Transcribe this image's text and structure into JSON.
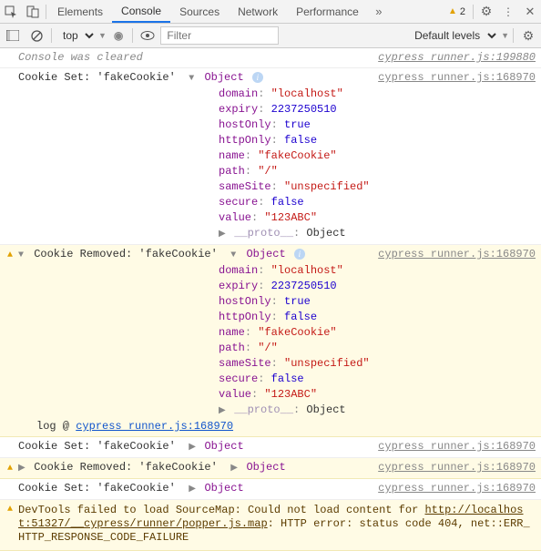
{
  "toolbar": {
    "tabs": [
      "Elements",
      "Console",
      "Sources",
      "Network",
      "Performance"
    ],
    "active_tab": "Console",
    "warning_count": "2"
  },
  "toolbar2": {
    "context": "top",
    "filter_placeholder": "Filter",
    "levels": "Default levels"
  },
  "messages": {
    "cleared": "Console was cleared",
    "cookie_set_label": "Cookie Set: 'fakeCookie'",
    "cookie_removed_label": "Cookie Removed: 'fakeCookie'",
    "object_label": "Object",
    "proto_label": "__proto__",
    "log_at_prefix": "log @ ",
    "log_at_link": "cypress runner.js:168970"
  },
  "sources": {
    "s199880": "cypress runner.js:199880",
    "s168970": "cypress runner.js:168970"
  },
  "cookie_obj": {
    "domain": {
      "k": "domain",
      "v": "\"localhost\"",
      "t": "str"
    },
    "expiry": {
      "k": "expiry",
      "v": "2237250510",
      "t": "num"
    },
    "hostOnly": {
      "k": "hostOnly",
      "v": "true",
      "t": "bool"
    },
    "httpOnly": {
      "k": "httpOnly",
      "v": "false",
      "t": "bool"
    },
    "name": {
      "k": "name",
      "v": "\"fakeCookie\"",
      "t": "str"
    },
    "path": {
      "k": "path",
      "v": "\"/\"",
      "t": "str"
    },
    "sameSite": {
      "k": "sameSite",
      "v": "\"unspecified\"",
      "t": "str"
    },
    "secure": {
      "k": "secure",
      "v": "false",
      "t": "bool"
    },
    "value": {
      "k": "value",
      "v": "\"123ABC\"",
      "t": "str"
    }
  },
  "sourcemap": {
    "pre": "DevTools failed to load SourceMap: Could not load content for ",
    "url": "http://localhost:51327/__cypress/runner/popper.js.map",
    "post": ": HTTP error: status code 404, net::ERR_HTTP_RESPONSE_CODE_FAILURE"
  }
}
